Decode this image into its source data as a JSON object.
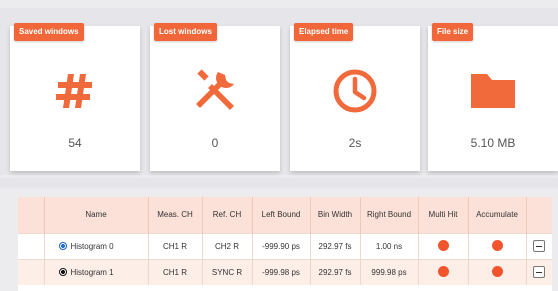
{
  "colors": {
    "accent": "#f26739",
    "icon": "#f06a3c",
    "row_highlight": "#fdeee8"
  },
  "cards": [
    {
      "label": "Saved windows",
      "value": "54",
      "icon": "hash-icon"
    },
    {
      "label": "Lost windows",
      "value": "0",
      "icon": "tools-icon"
    },
    {
      "label": "Elapsed time",
      "value": "2s",
      "icon": "clock-icon"
    },
    {
      "label": "File size",
      "value": "5.10 MB",
      "icon": "folder-icon"
    }
  ],
  "table": {
    "headers": [
      "",
      "Name",
      "Meas. CH",
      "Ref. CH",
      "Left Bound",
      "Bin Width",
      "Right Bound",
      "Multi Hit",
      "Accumulate",
      ""
    ],
    "rows": [
      {
        "name": "Histogram 0",
        "meas_ch": "CH1 R",
        "ref_ch": "CH2 R",
        "left_bound": "-999.90 ps",
        "bin_width": "292.97 fs",
        "right_bound": "1.00 ns",
        "multi_hit": true,
        "accumulate": true,
        "selected": true
      },
      {
        "name": "Histogram 1",
        "meas_ch": "CH1 R",
        "ref_ch": "SYNC R",
        "left_bound": "-999.98 ps",
        "bin_width": "292.97 fs",
        "right_bound": "999.98 ps",
        "multi_hit": true,
        "accumulate": true,
        "selected": false
      }
    ]
  }
}
